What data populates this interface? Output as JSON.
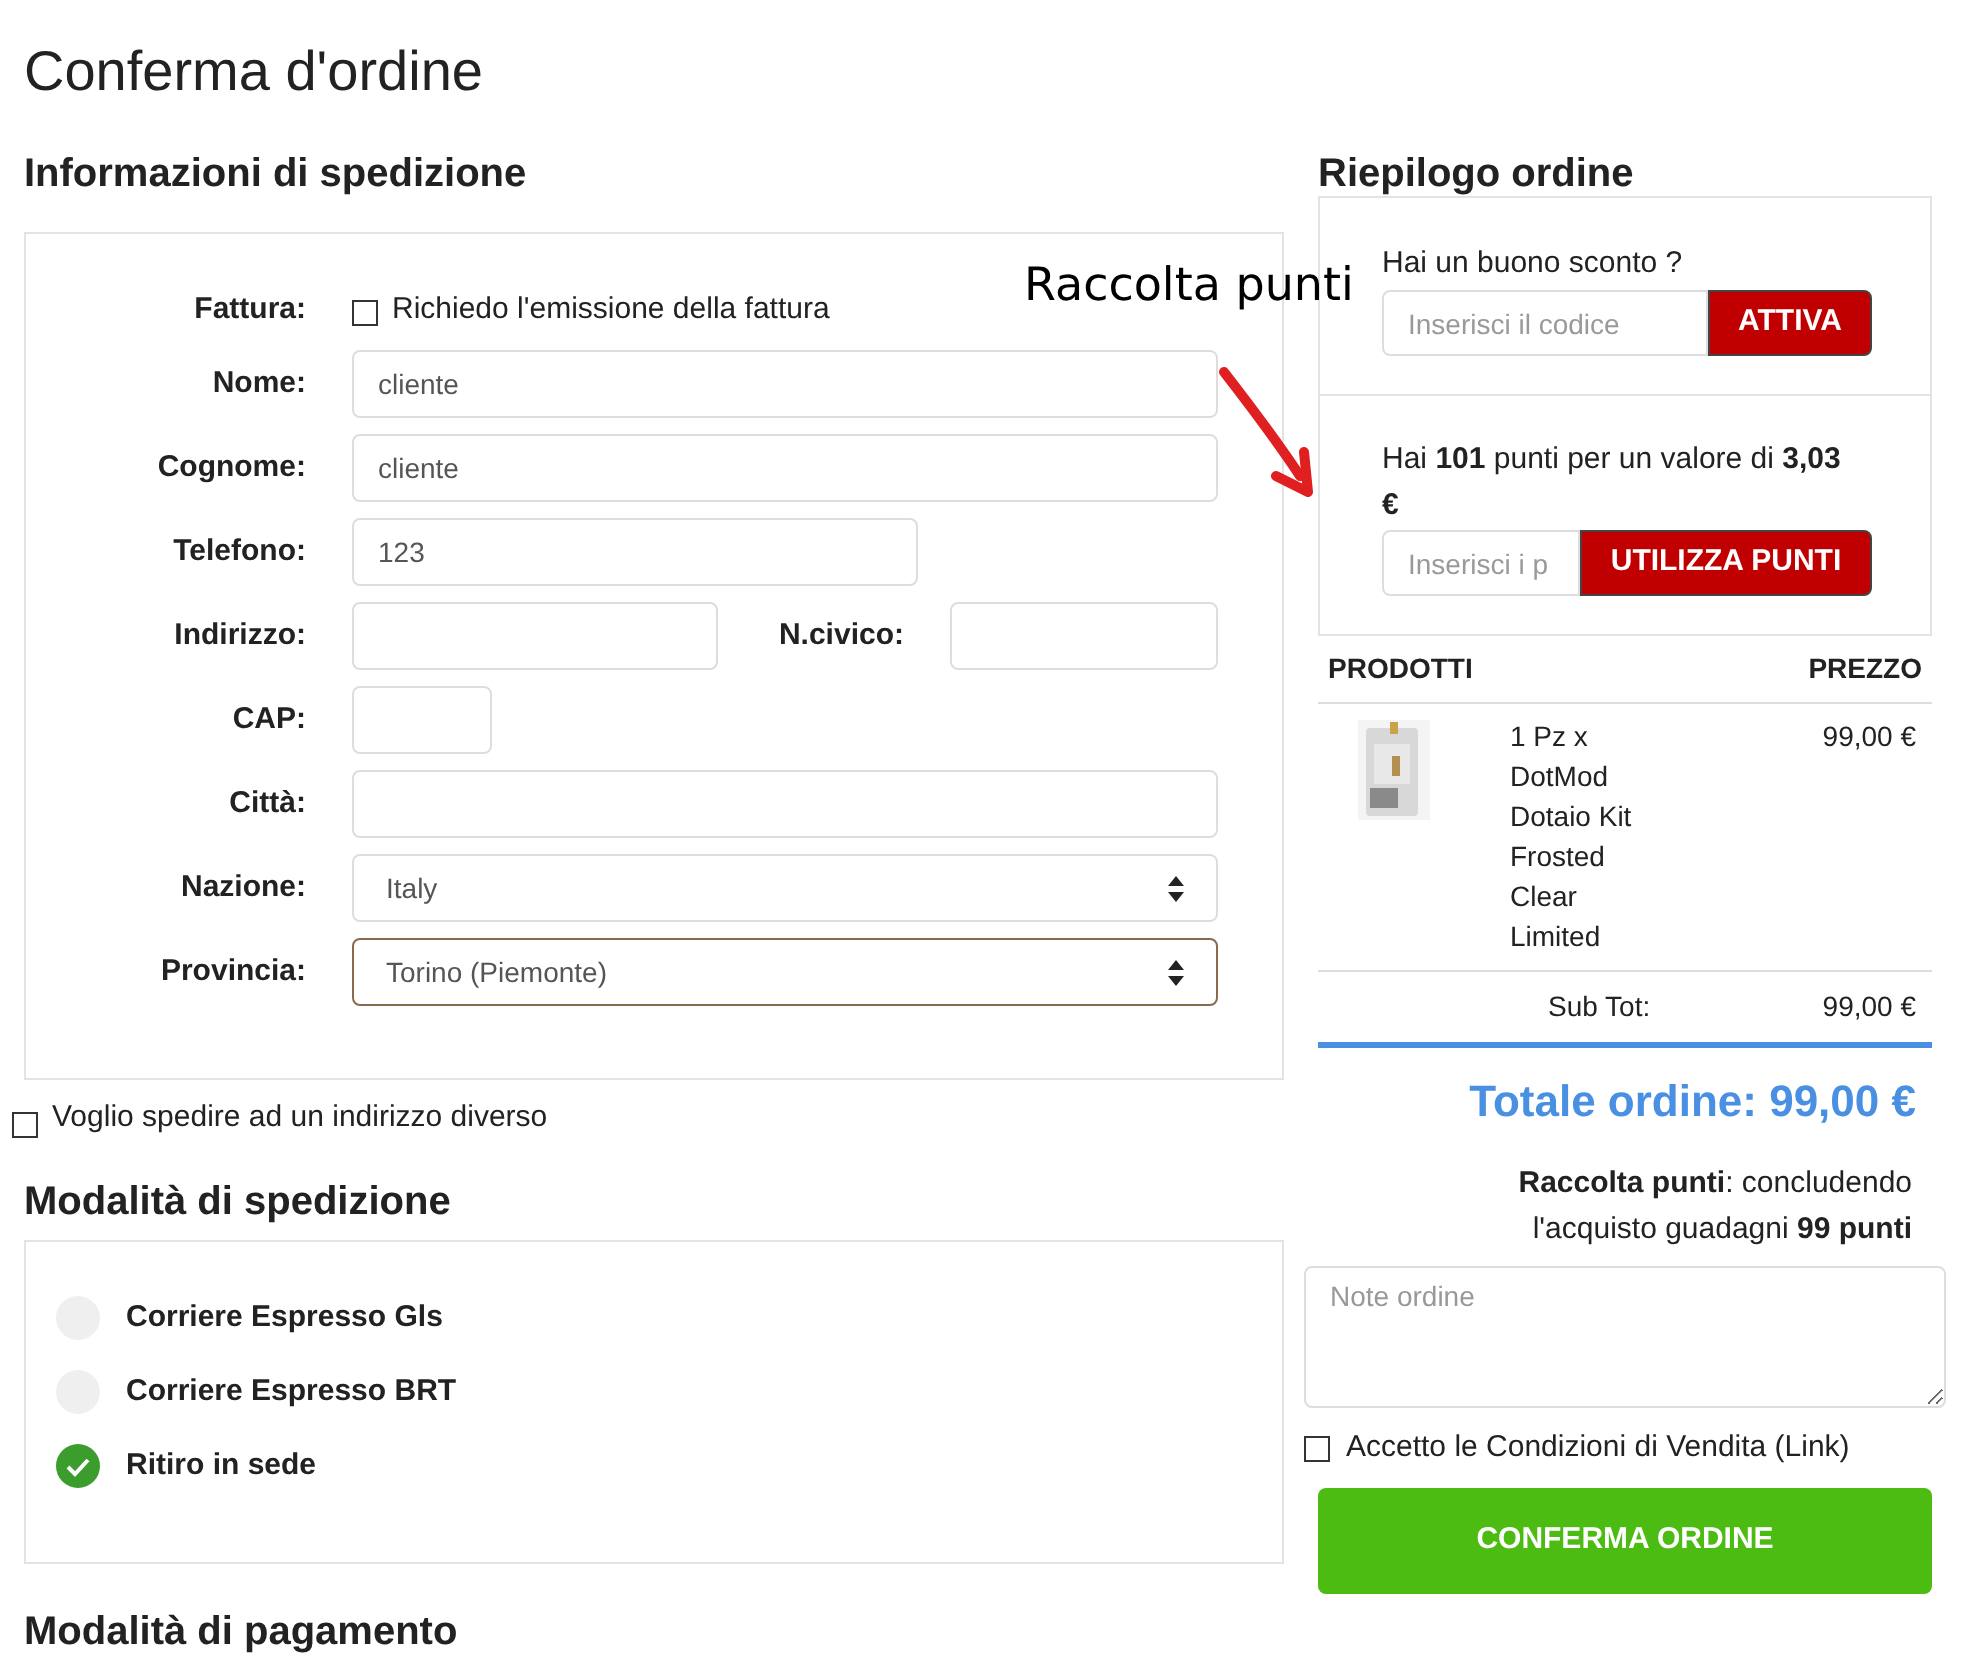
{
  "page_title": "Conferma d'ordine",
  "shipping_info": {
    "heading": "Informazioni di spedizione",
    "invoice": {
      "label": "Fattura:",
      "checkbox_label": "Richiedo l'emissione della fattura",
      "checked": false
    },
    "fields": [
      {
        "kind": "long",
        "label": "Nome:",
        "value": "cliente"
      },
      {
        "kind": "long",
        "label": "Cognome:",
        "value": "cliente"
      },
      {
        "kind": "medium",
        "label": "Telefono:",
        "value": "123"
      },
      {
        "kind": "pair",
        "label": "Indirizzo:",
        "second_label": "N.civico:"
      },
      {
        "kind": "short",
        "label": "CAP:"
      },
      {
        "kind": "long",
        "label": "Città:"
      },
      {
        "kind": "select",
        "label": "Nazione:",
        "value": "Italy",
        "focused": false
      },
      {
        "kind": "select",
        "label": "Provincia:",
        "value": "Torino (Piemonte)",
        "focused": true
      }
    ]
  },
  "different_address": {
    "label": "Voglio spedire ad un indirizzo diverso",
    "checked": false
  },
  "shipping_methods": {
    "heading": "Modalità di spedizione",
    "options": [
      {
        "label": "Corriere Espresso Gls",
        "selected": false
      },
      {
        "label": "Corriere Espresso BRT",
        "selected": false
      },
      {
        "label": "Ritiro in sede",
        "selected": true
      }
    ]
  },
  "payment_heading": "Modalità di pagamento",
  "summary": {
    "heading": "Riepilogo ordine",
    "voucher": {
      "question": "Hai un buono sconto ?",
      "placeholder": "Inserisci il codice",
      "button": "ATTIVA"
    },
    "points": {
      "text": "Hai **101** punti per un valore di **3,03 €**",
      "placeholder": "Inserisci i p",
      "button": "UTILIZZA PUNTI"
    },
    "columns": [
      "PRODOTTI",
      "PREZZO"
    ],
    "products": [
      {
        "kind": "picture",
        "lines": [
          "1 Pz x",
          "DotMod",
          "Dotaio Kit",
          "Frosted",
          "Clear",
          "Limited"
        ],
        "price": "99,00 €"
      }
    ],
    "subtotal_label": "Sub Tot:",
    "subtotal": "99,00 €",
    "total": "Totale ordine: 99,00 €",
    "points_note": "**Raccolta punti**: concludendo l'acquisto guadagni **99 punti**",
    "notes_placeholder": "Note ordine",
    "terms": {
      "label": "Accetto le Condizioni di Vendita (Link)",
      "checked": false
    },
    "confirm_button": "CONFERMA ORDINE"
  },
  "annotation": {
    "text": "Raccolta punti"
  }
}
